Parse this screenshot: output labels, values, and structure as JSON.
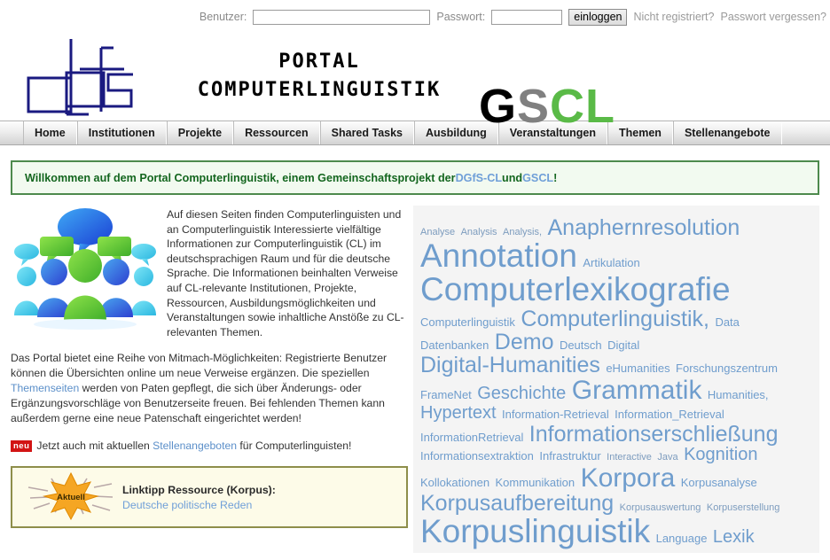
{
  "login": {
    "user_label": "Benutzer:",
    "user_value": "",
    "user_placeholder": "",
    "pass_label": "Passwort:",
    "pass_value": "",
    "pass_placeholder": "",
    "submit_label": "einloggen",
    "register_link": "Nicht registriert?",
    "forgot_link": "Passwort vergessen?"
  },
  "header": {
    "portal_line1": "PORTAL",
    "portal_line2": "COMPUTERLINGUISTIK",
    "gscl_g": "G",
    "gscl_s": "S",
    "gscl_cl": "CL",
    "dgfs_alt": "dgfs"
  },
  "nav": {
    "items": [
      {
        "label": "Home"
      },
      {
        "label": "Institutionen"
      },
      {
        "label": "Projekte"
      },
      {
        "label": "Ressourcen"
      },
      {
        "label": "Shared Tasks"
      },
      {
        "label": "Ausbildung"
      },
      {
        "label": "Veranstaltungen"
      },
      {
        "label": "Themen"
      },
      {
        "label": "Stellenangebote"
      }
    ]
  },
  "welcome": {
    "part1": "Willkommen auf dem Portal Computerlinguistik, einem Gemeinschaftsprojekt der ",
    "link1": "DGfS-CL",
    "part2": " und ",
    "link2": "GSCL",
    "part3": "!"
  },
  "intro": {
    "text": "Auf diesen Seiten finden Computerlinguisten und an Computerlinguistik Interessierte vielfältige Informationen zur Computerlinguistik (CL) im deutschsprachigen Raum und für die deutsche Sprache. Die Informationen beinhalten Verweise auf CL-relevante Institutionen, Projekte, Ressourcen, Ausbildungsmöglichkeiten und Veranstaltungen sowie inhaltliche Anstöße zu CL-relevanten Themen.",
    "para2_part1": "Das Portal bietet eine Reihe von Mitmach-Möglichkeiten: Registrierte Benutzer können die Übersichten online um neue Verweise ergänzen. Die speziellen ",
    "para2_link": "Themenseiten",
    "para2_part2": " werden von Paten gepflegt, die sich über Änderungs- oder Ergänzungsvorschläge von Benutzerseite freuen. Bei fehlenden Themen kann außerdem gerne eine neue Patenschaft eingerichtet werden!",
    "neu_badge": "neu",
    "neu_part1": "Jetzt auch mit aktuellen ",
    "neu_link": "Stellenangeboten",
    "neu_part2": " für Computerlinguisten!"
  },
  "linktipp": {
    "burst_label": "Aktuell",
    "title": "Linktipp Ressource (Korpus):",
    "link": "Deutsche politische Reden"
  },
  "tagcloud": {
    "tags": [
      {
        "label": "Analyse",
        "size": 1
      },
      {
        "label": "Analysis",
        "size": 1
      },
      {
        "label": "Analysis,",
        "size": 1
      },
      {
        "label": "Anaphernresolution",
        "size": 5
      },
      {
        "label": "Annotation",
        "size": 7
      },
      {
        "label": "Artikulation",
        "size": 2
      },
      {
        "label": "Computerlexikografie",
        "size": 7
      },
      {
        "label": "Computerlinguistik",
        "size": 2
      },
      {
        "label": "Computerlinguistik,",
        "size": 5
      },
      {
        "label": "Data",
        "size": 2
      },
      {
        "label": "Datenbanken",
        "size": 2
      },
      {
        "label": "Demo",
        "size": 5
      },
      {
        "label": "Deutsch",
        "size": 2
      },
      {
        "label": "Digital",
        "size": 2
      },
      {
        "label": "Digital-Humanities",
        "size": 5
      },
      {
        "label": "eHumanities",
        "size": 2
      },
      {
        "label": "Forschungszentrum",
        "size": 2
      },
      {
        "label": "FrameNet",
        "size": 2
      },
      {
        "label": "Geschichte",
        "size": 4
      },
      {
        "label": "Grammatik",
        "size": 6
      },
      {
        "label": "Humanities,",
        "size": 2
      },
      {
        "label": "Hypertext",
        "size": 4
      },
      {
        "label": "Information-Retrieval",
        "size": 2
      },
      {
        "label": "Information_Retrieval",
        "size": 2
      },
      {
        "label": "InformationRetrieval",
        "size": 2
      },
      {
        "label": "Informationserschließung",
        "size": 5
      },
      {
        "label": "Informationsextraktion",
        "size": 2
      },
      {
        "label": "Infrastruktur",
        "size": 2
      },
      {
        "label": "Interactive",
        "size": 1
      },
      {
        "label": "Java",
        "size": 1
      },
      {
        "label": "Kognition",
        "size": 4
      },
      {
        "label": "Kollokationen",
        "size": 2
      },
      {
        "label": "Kommunikation",
        "size": 2
      },
      {
        "label": "Korpora",
        "size": 6
      },
      {
        "label": "Korpusanalyse",
        "size": 2
      },
      {
        "label": "Korpusaufbereitung",
        "size": 5
      },
      {
        "label": "Korpusauswertung",
        "size": 1
      },
      {
        "label": "Korpuserstellung",
        "size": 1
      },
      {
        "label": "Korpuslinguistik",
        "size": 7
      },
      {
        "label": "Language",
        "size": 2
      },
      {
        "label": "Lexik",
        "size": 4
      }
    ]
  },
  "colors": {
    "brand_green": "#5aba47",
    "dgfs_navy": "#1a1a80",
    "tag_blue": "#6f9dcd",
    "link_blue": "#5b8fc9",
    "welcome_green": "#14661f",
    "neu_red": "#d21414"
  }
}
